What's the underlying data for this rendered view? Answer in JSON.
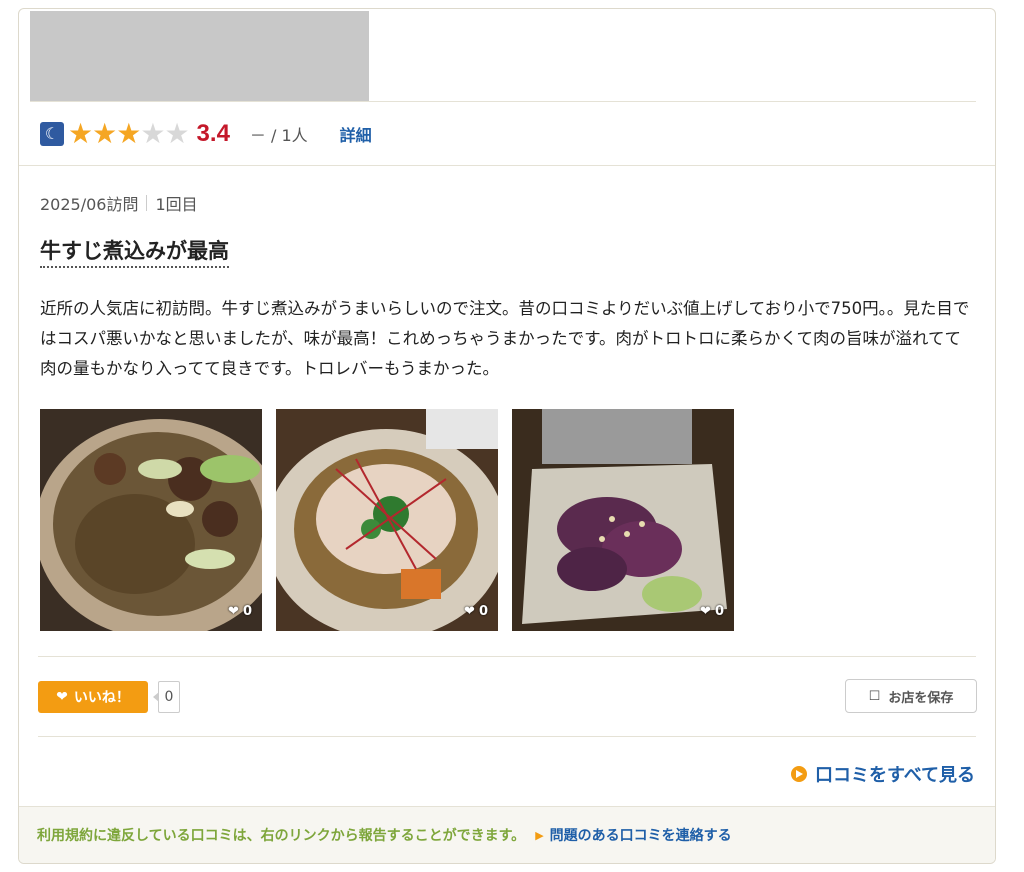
{
  "header": {
    "rating_icon": "moon-icon",
    "stars_filled": 3,
    "stars_total": 5,
    "score": "3.4",
    "reviewers": "－ / 1人",
    "detail_link": "詳細"
  },
  "review": {
    "visit_date": "2025/06訪問",
    "visit_count": "1回目",
    "title": "牛すじ煮込みが最高",
    "body": "近所の人気店に初訪問。牛すじ煮込みがうまいらしいので注文。昔の口コミよりだいぶ値上げしており小で750円。。見た目ではコスパ悪いかなと思いましたが、味が最高！これめっちゃうまかったです。肉がトロトロに柔らかくて肉の旨味が溢れてて肉の量もかなり入ってて良きです。トロレバーもうまかった。",
    "photos": [
      {
        "likes": "0"
      },
      {
        "likes": "0"
      },
      {
        "likes": "0"
      }
    ]
  },
  "actions": {
    "like_label": "いいね！",
    "like_count": "0",
    "save_label": "お店を保存",
    "see_all": "口コミをすべて見る"
  },
  "footer": {
    "note": "利用規約に違反している口コミは、右のリンクから報告することができます。",
    "report_link": "問題のある口コミを連絡する"
  },
  "colors": {
    "accent_orange": "#f39c12",
    "score_red": "#c4182a",
    "link_blue": "#1f5fa8",
    "note_green": "#7ea63b"
  }
}
